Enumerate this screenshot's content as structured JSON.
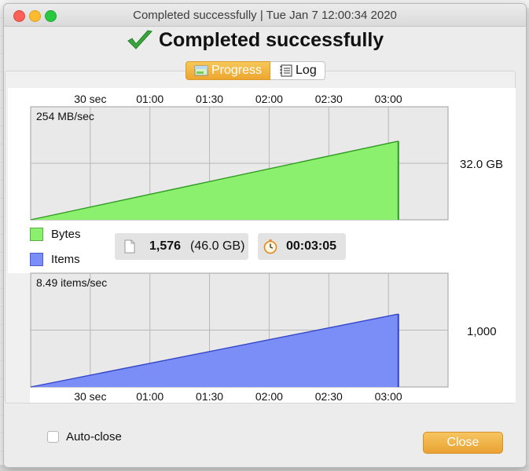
{
  "window": {
    "title": "Completed successfully | Tue Jan  7 12:00:34 2020",
    "headline": "Completed successfully"
  },
  "tabs": [
    {
      "label": "Progress",
      "icon": "progress-icon",
      "selected": true
    },
    {
      "label": "Log",
      "icon": "log-icon",
      "selected": false
    }
  ],
  "stats": {
    "file_count": "1,576",
    "total_size": "(46.0 GB)",
    "elapsed": "00:03:05"
  },
  "legend": {
    "bytes_label": "Bytes",
    "items_label": "Items"
  },
  "footer": {
    "auto_close_label": "Auto-close",
    "auto_close_checked": false,
    "close_label": "Close"
  },
  "colors": {
    "bytes_fill": "#8cf06f",
    "bytes_line": "#2f9a22",
    "items_fill": "#7b8df6",
    "items_line": "#3346c8",
    "accent": "#eda62e"
  },
  "chart_data": [
    {
      "type": "area",
      "name": "bytes",
      "rate_label": "254 MB/sec",
      "side_value": "32.0 GB",
      "x_tick_labels": [
        "30 sec",
        "01:00",
        "01:30",
        "02:00",
        "02:30",
        "03:00"
      ],
      "x_ticks_sec": [
        30,
        60,
        90,
        120,
        150,
        180
      ],
      "xlim": [
        0,
        210
      ],
      "ylim": [
        0,
        46
      ],
      "grid": true,
      "series": [
        {
          "x": [
            0,
            185
          ],
          "y": [
            0,
            32.0
          ]
        }
      ]
    },
    {
      "type": "area",
      "name": "items",
      "rate_label": "8.49 items/sec",
      "side_value": "1,000",
      "x_tick_labels": [
        "30 sec",
        "01:00",
        "01:30",
        "02:00",
        "02:30",
        "03:00"
      ],
      "x_ticks_sec": [
        30,
        60,
        90,
        120,
        150,
        180
      ],
      "xlim": [
        0,
        210
      ],
      "ylim": [
        0,
        1560
      ],
      "grid": true,
      "series": [
        {
          "x": [
            0,
            185
          ],
          "y": [
            0,
            1000
          ]
        }
      ]
    }
  ]
}
